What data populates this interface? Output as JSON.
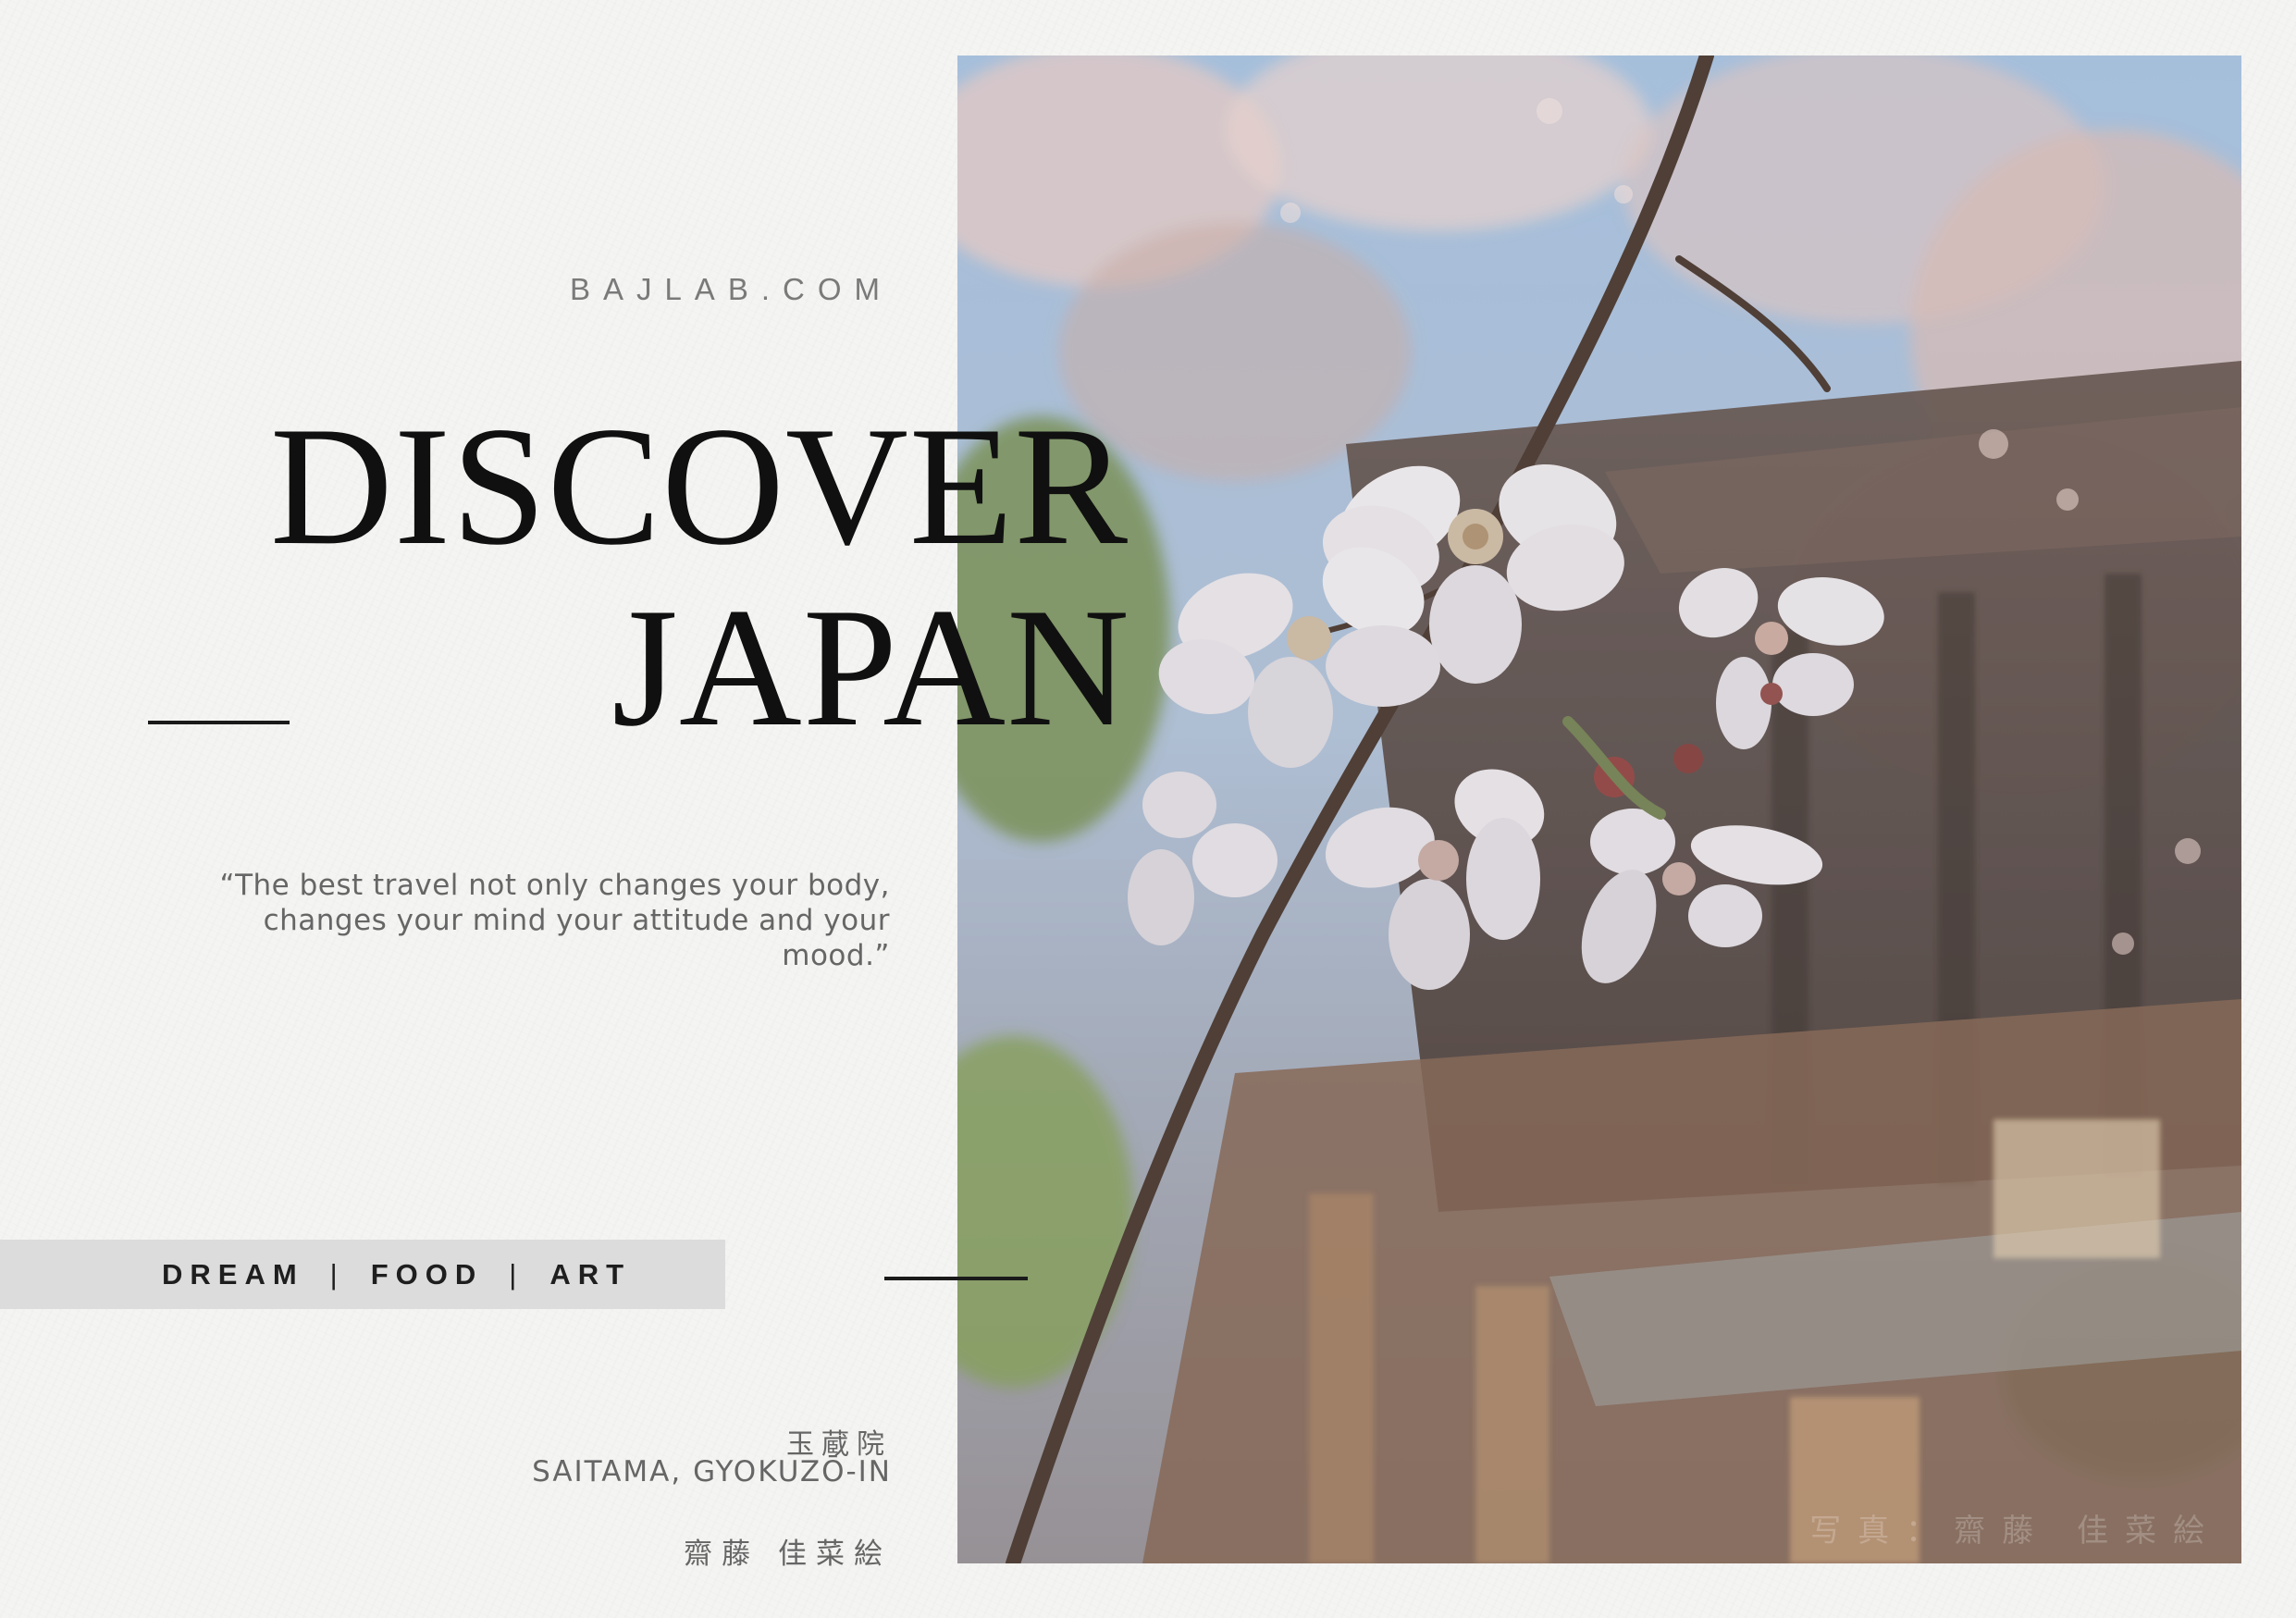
{
  "header": {
    "site": "BAJLAB.COM"
  },
  "title": {
    "line1": "DISCOVER",
    "line2": "JAPAN"
  },
  "quote": {
    "text": "“The best travel not only changes your body, changes your mind your attitude and your mood.”"
  },
  "tags": {
    "items": [
      "DREAM",
      "FOOD",
      "ART"
    ],
    "separator": "|"
  },
  "location": {
    "japanese": "玉蔵院",
    "english": "SAITAMA, GYOKUZŌ-IN"
  },
  "author": {
    "name": "齋藤 佳菜絵"
  },
  "photo": {
    "subject": "cherry blossom branch in front of a temple building",
    "credit": "写真：齋藤 佳菜絵"
  },
  "colors": {
    "background": "#f4f4f2",
    "title": "#101010",
    "body_text": "#666666",
    "tag_bar": "#dcdcdc"
  }
}
